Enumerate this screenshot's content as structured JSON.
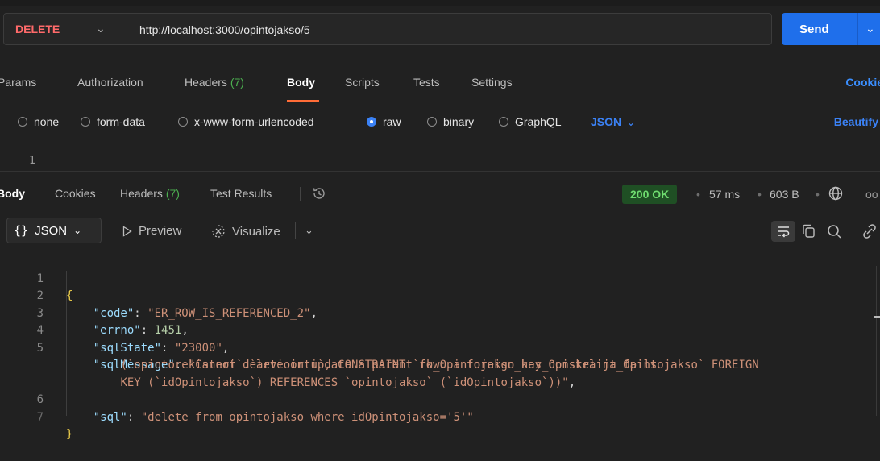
{
  "request": {
    "method": "DELETE",
    "url": "http://localhost:3000/opintojakso/5",
    "send_label": "Send"
  },
  "request_tabs": {
    "params": "Params",
    "authorization": "Authorization",
    "headers": "Headers",
    "headers_count": "(7)",
    "body": "Body",
    "scripts": "Scripts",
    "tests": "Tests",
    "settings": "Settings",
    "cookies": "Cookie"
  },
  "body_types": {
    "none": "none",
    "form_data": "form-data",
    "urlencoded": "x-www-form-urlencoded",
    "raw": "raw",
    "binary": "binary",
    "graphql": "GraphQL",
    "format": "JSON",
    "beautify": "Beautify",
    "selected": "raw"
  },
  "request_editor": {
    "line_1": "1"
  },
  "response_tabs": {
    "body": "Body",
    "cookies": "Cookies",
    "headers": "Headers",
    "headers_count": "(7)",
    "test_results": "Test Results"
  },
  "response_status": {
    "status": "200 OK",
    "time": "57 ms",
    "size": "603 B"
  },
  "response_toolbar": {
    "mode": "JSON",
    "preview": "Preview",
    "visualize": "Visualize"
  },
  "response_body": {
    "line_numbers": [
      "1",
      "2",
      "3",
      "4",
      "5",
      "",
      "",
      "6",
      "7"
    ],
    "code_key": "\"code\"",
    "code_val": "\"ER_ROW_IS_REFERENCED_2\"",
    "errno_key": "\"errno\"",
    "errno_val": "1451",
    "sqlstate_key": "\"sqlState\"",
    "sqlstate_val": "\"23000\"",
    "sqlmessage_key": "\"sqlMessage\"",
    "sqlmessage_val_1": "\"Cannot delete or update a parent row: a foreign key constraint fails",
    "sqlmessage_val_2": "(`opintorekisteri`.`arviointi`, CONSTRAINT `fk_Opintojakso_has_Opiskelija_Opintojakso` FOREIGN",
    "sqlmessage_val_3": "KEY (`idOpintojakso`) REFERENCES `opintojakso` (`idOpintojakso`))\"",
    "sql_key": "\"sql\"",
    "sql_val": "\"delete from opintojakso where idOpintojakso='5'\""
  },
  "colors": {
    "method": "#ff6a6a",
    "send": "#1f6feb",
    "accent_tab": "#ff6c37",
    "status_ok": "#6fdc6f",
    "link": "#3b82f6"
  }
}
